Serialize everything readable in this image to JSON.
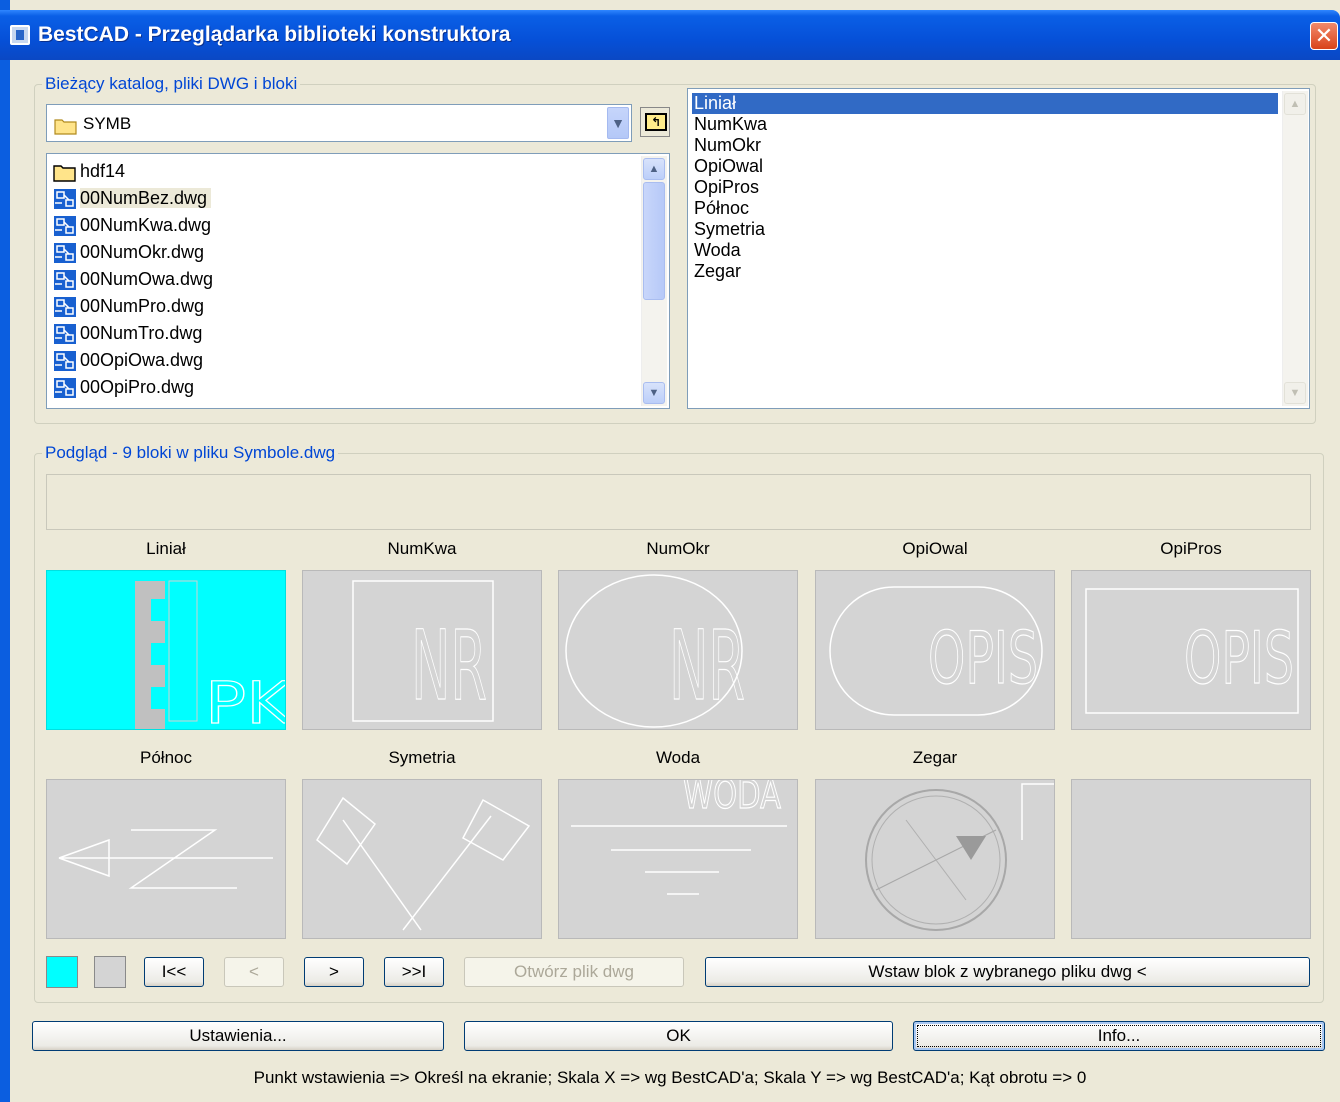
{
  "window": {
    "title": "BestCAD - Przeglądarka biblioteki konstruktora",
    "close_glyph": "✕"
  },
  "catalog_group": {
    "label": "Bieżący katalog, pliki DWG i bloki",
    "current_folder": "SYMB",
    "up_glyph": "↰",
    "files": [
      {
        "name": "hdf14",
        "icon": "folder-icon"
      },
      {
        "name": "00NumBez.dwg",
        "icon": "dwg-file-icon",
        "selected": true
      },
      {
        "name": "00NumKwa.dwg",
        "icon": "dwg-file-icon"
      },
      {
        "name": "00NumOkr.dwg",
        "icon": "dwg-file-icon"
      },
      {
        "name": "00NumOwa.dwg",
        "icon": "dwg-file-icon"
      },
      {
        "name": "00NumPro.dwg",
        "icon": "dwg-file-icon"
      },
      {
        "name": "00NumTro.dwg",
        "icon": "dwg-file-icon"
      },
      {
        "name": "00OpiOwa.dwg",
        "icon": "dwg-file-icon"
      },
      {
        "name": "00OpiPro.dwg",
        "icon": "dwg-file-icon"
      }
    ],
    "blocks": [
      "Liniał",
      "NumKwa",
      "NumOkr",
      "OpiOwal",
      "OpiPros",
      "Północ",
      "Symetria",
      "Woda",
      "Zegar"
    ],
    "selected_block": "Liniał"
  },
  "preview_group": {
    "label": "Podgląd - 9 bloki w pliku Symbole.dwg",
    "thumbnails": [
      {
        "label": "Liniał",
        "text": "PK"
      },
      {
        "label": "NumKwa",
        "text": "NR"
      },
      {
        "label": "NumOkr",
        "text": "NR"
      },
      {
        "label": "OpiOwal",
        "text": "OPIS"
      },
      {
        "label": "OpiPros",
        "text": "OPIS"
      },
      {
        "label": "Północ",
        "text": ""
      },
      {
        "label": "Symetria",
        "text": ""
      },
      {
        "label": "Woda",
        "text": "WODA"
      },
      {
        "label": "Zegar",
        "text": ""
      },
      {
        "label": "",
        "text": ""
      }
    ],
    "swatches": {
      "active": "#00ffff",
      "inactive": "#d4d4d4"
    },
    "nav": {
      "first": "I<<",
      "prev": "<",
      "next": ">",
      "last": ">>I"
    },
    "open_dwg": "Otwórz plik dwg",
    "insert_block": "Wstaw blok z wybranego pliku dwg <"
  },
  "buttons": {
    "settings": "Ustawienia...",
    "ok": "OK",
    "info": "Info..."
  },
  "status_text": "Punkt wstawienia => Określ na ekranie; Skala X => wg BestCAD'a; Skala Y => wg BestCAD'a; Kąt obrotu => 0"
}
